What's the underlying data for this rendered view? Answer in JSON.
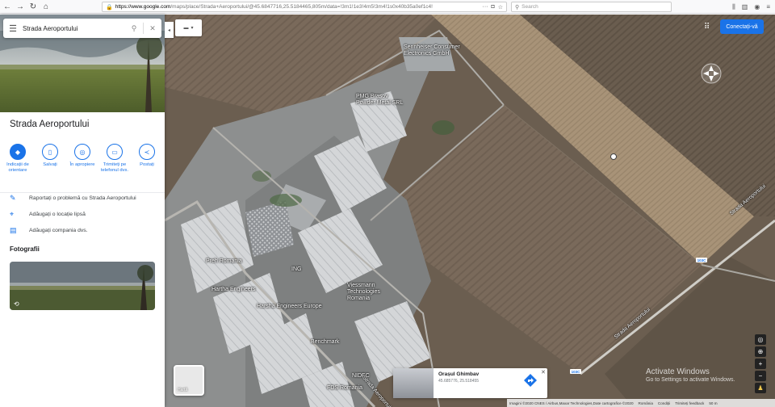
{
  "browser": {
    "url_domain": "https://www.google.com",
    "url_path": "/maps/place/Strada+Aeroportului/@45.6847716,25.5184465,805m/data=!3m1!1e3!4m5!3m4!1s0x40b35a0ef1c4!",
    "search_placeholder": "Search"
  },
  "panel": {
    "search_value": "Strada Aeroportului",
    "place_title": "Strada Aeroportului",
    "actions": [
      {
        "label": "Indicații de orientare",
        "icon": "directions-icon"
      },
      {
        "label": "Salvați",
        "icon": "bookmark-icon"
      },
      {
        "label": "În apropiere",
        "icon": "nearby-icon"
      },
      {
        "label": "Trimiteți pe telefonul dvs.",
        "icon": "phone-icon"
      },
      {
        "label": "Postați",
        "icon": "share-icon"
      }
    ],
    "links": [
      {
        "label": "Raportați o problemă cu Strada Aeroportului",
        "icon": "pencil-icon"
      },
      {
        "label": "Adăugați o locație lipsă",
        "icon": "add-location-icon"
      },
      {
        "label": "Adăugați compania dvs.",
        "icon": "business-icon"
      }
    ],
    "photos_heading": "Fotografii"
  },
  "map": {
    "signin_label": "Conectați-vă",
    "minimap_label": "Hartă",
    "labels": [
      {
        "text": "Sennheiser Consumer Electronics GmbH"
      },
      {
        "text": "PMG Brasov Powder Metal SRL"
      },
      {
        "text": "Preh Romania"
      },
      {
        "text": "Hartha Engineers"
      },
      {
        "text": "Viessmann Technologies Romania"
      },
      {
        "text": "Harsha Engineers Europe"
      },
      {
        "text": "ING"
      },
      {
        "text": "Benchmark"
      },
      {
        "text": "NIDEC"
      },
      {
        "text": "FDS Romania"
      }
    ],
    "road_labels": [
      "Strada Aeroportului",
      "Strada Aeroportului",
      "Strada Aeroportului"
    ],
    "road_shields": [
      "103C",
      "103C"
    ],
    "info_card": {
      "title": "Orașul Ghimbav",
      "coords": "45.685776, 25.518455"
    },
    "footer": {
      "imagery": "Imagini ©2020 CNES / Airbus,Maxar Technologies,Date cartografice ©2020",
      "country": "România",
      "terms": "Condiții",
      "feedback": "Trimiteți feedback",
      "scale": "50 m"
    },
    "watermark_line1": "Activate Windows",
    "watermark_line2": "Go to Settings to activate Windows."
  }
}
